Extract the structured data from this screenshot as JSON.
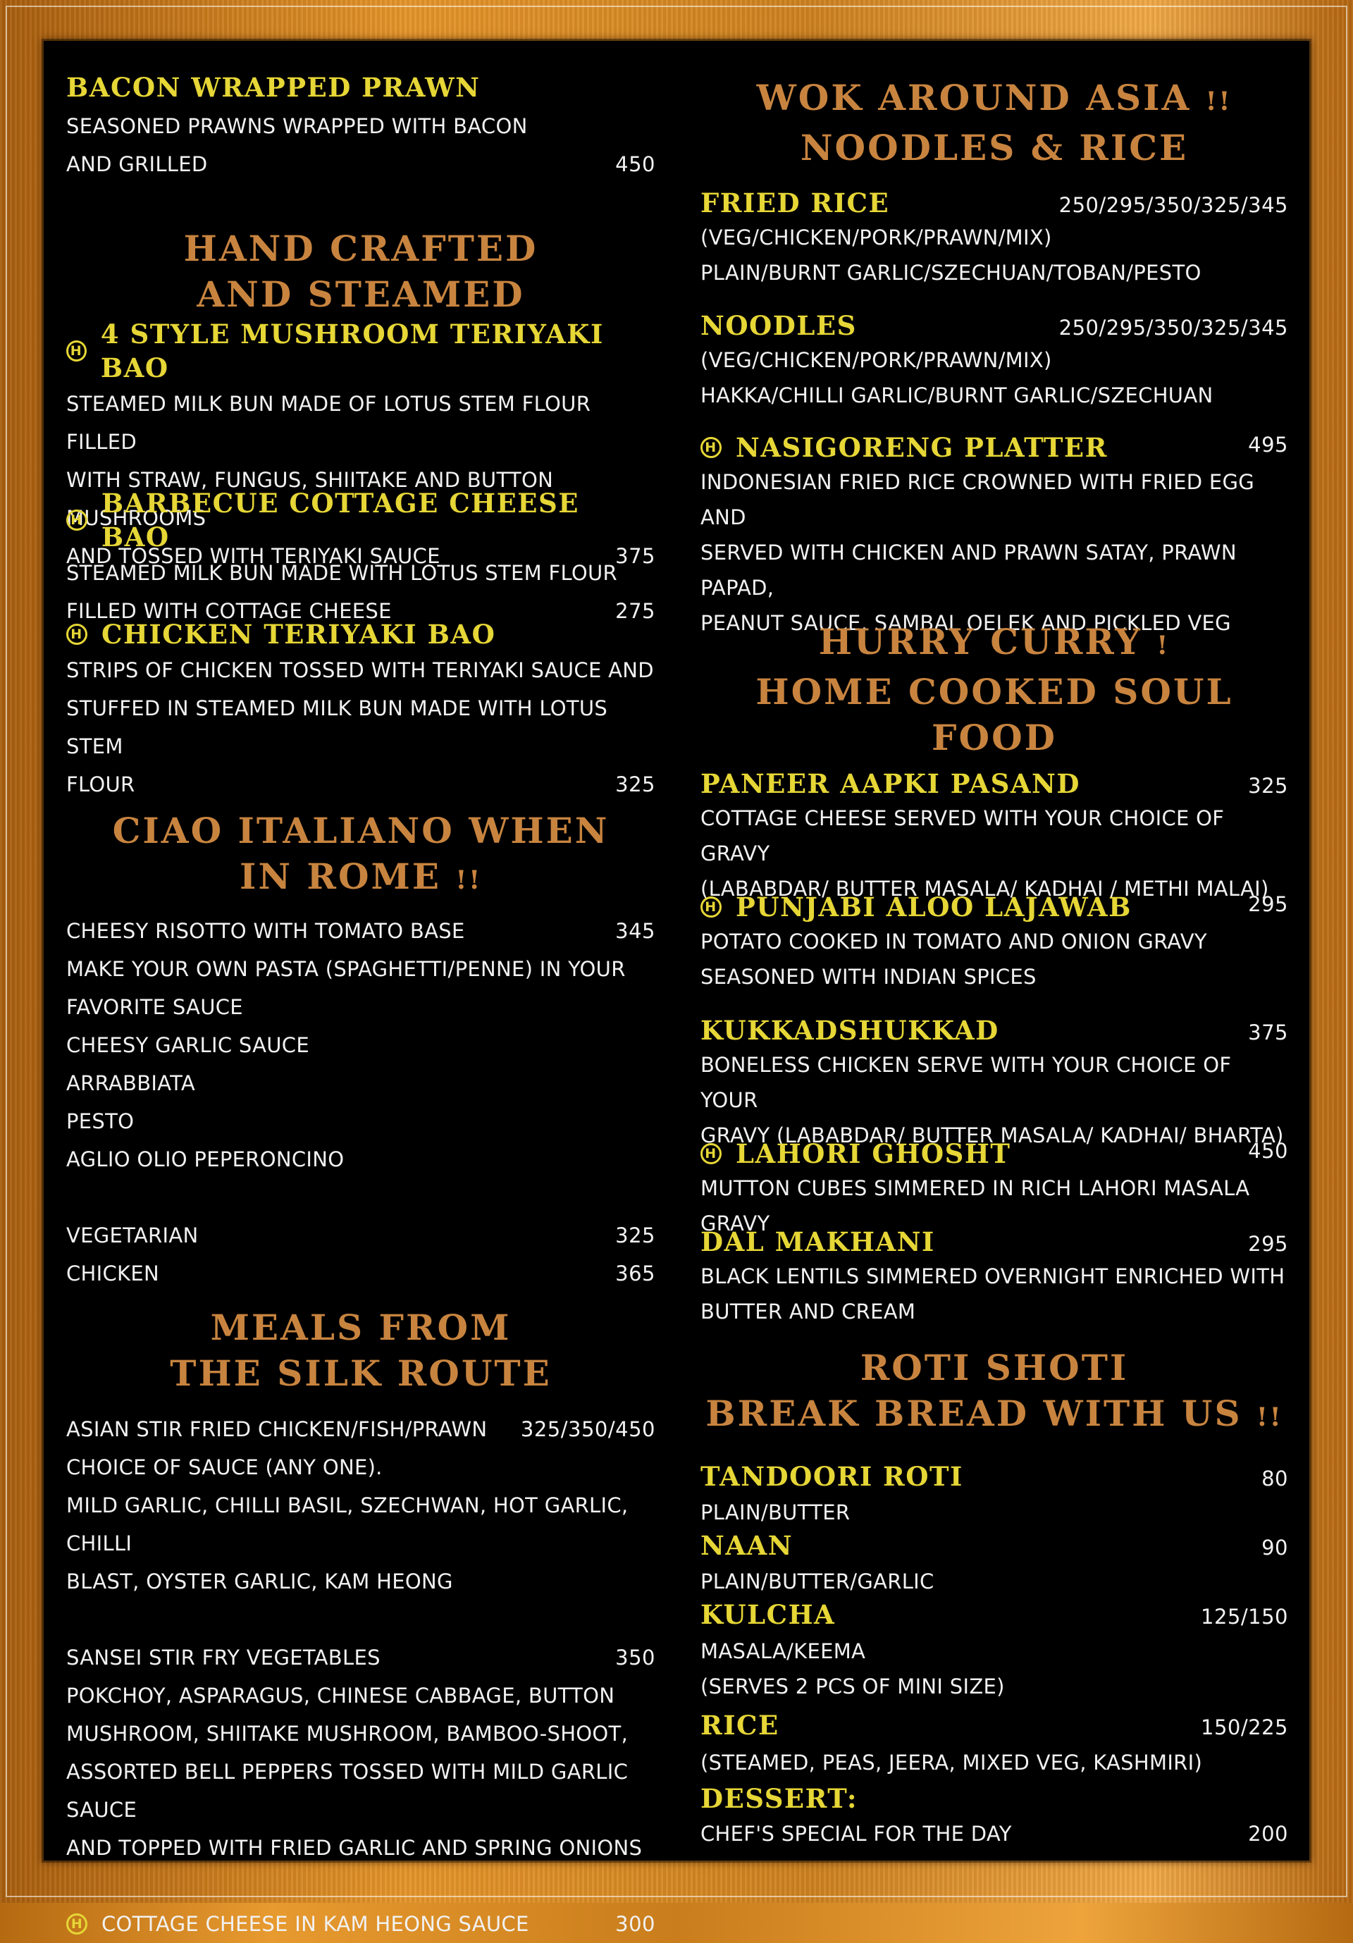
{
  "left": {
    "bacon": {
      "name": "BACON WRAPPED PRAWN",
      "desc1": "SEASONED PRAWNS WRAPPED WITH BACON",
      "desc2": "AND GRILLED",
      "price": "450"
    },
    "h1": {
      "line1": "HAND CRAFTED",
      "line2": "AND STEAMED"
    },
    "mushroom_bao": {
      "name": "4 STYLE MUSHROOM TERIYAKI BAO",
      "desc1": "STEAMED MILK BUN MADE OF LOTUS STEM FLOUR FILLED",
      "desc2": "WITH STRAW, FUNGUS, SHIITAKE AND BUTTON MUSHROOMS",
      "desc3": "AND TOSSED WITH TERIYAKI SAUCE",
      "price": "375"
    },
    "cheese_bao": {
      "name": "BARBECUE COTTAGE CHEESE BAO",
      "desc1": "STEAMED MILK BUN MADE WITH LOTUS STEM FLOUR",
      "desc2": "FILLED WITH COTTAGE CHEESE",
      "price": "275"
    },
    "chicken_bao": {
      "name": "CHICKEN TERIYAKI BAO",
      "desc1": "STRIPS OF CHICKEN TOSSED WITH TERIYAKI SAUCE AND",
      "desc2": "STUFFED IN STEAMED MILK BUN MADE WITH LOTUS STEM",
      "desc3": "FLOUR",
      "price": "325"
    },
    "h2": {
      "line1": "CIAO ITALIANO WHEN",
      "line2": "IN ROME",
      "bang": "!!"
    },
    "italian": {
      "risotto": "CHEESY RISOTTO WITH TOMATO BASE",
      "risotto_price": "345",
      "pasta1": "MAKE YOUR OWN PASTA (SPAGHETTI/PENNE) IN YOUR",
      "pasta2": "FAVORITE SAUCE",
      "sauce1": "CHEESY GARLIC SAUCE",
      "sauce2": "ARRABBIATA",
      "sauce3": "PESTO",
      "sauce4": "AGLIO OLIO PEPERONCINO",
      "veg": "VEGETARIAN",
      "veg_price": "325",
      "chicken": "CHICKEN",
      "chicken_price": "365"
    },
    "h3": {
      "line1": "MEALS FROM",
      "line2": "THE SILK ROUTE"
    },
    "silk": {
      "stirfry": "ASIAN STIR FRIED CHICKEN/FISH/PRAWN",
      "stirfry_price": "325/350/450",
      "choice": "CHOICE OF SAUCE (ANY ONE).",
      "sauces1": "MILD GARLIC, CHILLI BASIL, SZECHWAN, HOT GARLIC, CHILLI",
      "sauces2": "BLAST, OYSTER GARLIC, KAM HEONG",
      "sansei": "SANSEI STIR FRY VEGETABLES",
      "sansei_price": "350",
      "sansei1": "POKCHOY, ASPARAGUS, CHINESE CABBAGE, BUTTON",
      "sansei2": "MUSHROOM, SHIITAKE MUSHROOM, BAMBOO-SHOOT,",
      "sansei3": "ASSORTED BELL PEPPERS TOSSED WITH MILD GARLIC SAUCE",
      "sansei4": "AND TOPPED WITH FRIED GARLIC AND SPRING ONIONS",
      "kam": "COTTAGE CHEESE IN KAM HEONG SAUCE",
      "kam_price": "300"
    }
  },
  "right": {
    "h1": {
      "line1": "WOK AROUND ASIA",
      "bang": "!!",
      "line2": "NOODLES & RICE"
    },
    "fried_rice": {
      "name": "FRIED RICE",
      "price": "250/295/350/325/345",
      "desc1": "(VEG/CHICKEN/PORK/PRAWN/MIX)",
      "desc2": "PLAIN/BURNT GARLIC/SZECHUAN/TOBAN/PESTO"
    },
    "noodles": {
      "name": "NOODLES",
      "price": "250/295/350/325/345",
      "desc1": "(VEG/CHICKEN/PORK/PRAWN/MIX)",
      "desc2": "HAKKA/CHILLI GARLIC/BURNT GARLIC/SZECHUAN"
    },
    "nasi": {
      "name": "NASIGORENG PLATTER",
      "price": "495",
      "desc1": "INDONESIAN FRIED RICE CROWNED WITH FRIED EGG AND",
      "desc2": "SERVED WITH CHICKEN AND PRAWN SATAY, PRAWN PAPAD,",
      "desc3": "PEANUT SAUCE, SAMBAL OELEK AND PICKLED VEG"
    },
    "h2": {
      "line1": "HURRY CURRY",
      "bang": "!",
      "line2": "HOME COOKED SOUL",
      "line3": "FOOD"
    },
    "paneer": {
      "name": "PANEER AAPKI PASAND",
      "price": "325",
      "desc1": "COTTAGE CHEESE SERVED WITH YOUR CHOICE OF GRAVY",
      "desc2": "(LABABDAR/ BUTTER MASALA/ KADHAI / METHI MALAI)"
    },
    "aloo": {
      "name": "PUNJABI ALOO LAJAWAB",
      "price": "295",
      "desc1": "POTATO COOKED IN TOMATO AND ONION GRAVY",
      "desc2": "SEASONED WITH INDIAN SPICES"
    },
    "kukkad": {
      "name": "KUKKADSHUKKAD",
      "price": "375",
      "desc1": "BONELESS CHICKEN SERVE WITH YOUR CHOICE OF YOUR",
      "desc2": "GRAVY (LABABDAR/ BUTTER MASALA/ KADHAI/ BHARTA)"
    },
    "lahori": {
      "name": "LAHORI GHOSHT",
      "price": "450",
      "desc1": "MUTTON CUBES SIMMERED IN RICH LAHORI MASALA GRAVY"
    },
    "dal": {
      "name": "DAL MAKHANI",
      "price": "295",
      "desc1": "BLACK LENTILS SIMMERED OVERNIGHT ENRICHED WITH",
      "desc2": "BUTTER AND CREAM"
    },
    "h3": {
      "line1": "ROTI SHOTI",
      "line2": "BREAK BREAD WITH US",
      "bang": "!!"
    },
    "roti": {
      "name": "TANDOORI ROTI",
      "price": "80",
      "desc1": "PLAIN/BUTTER"
    },
    "naan": {
      "name": "NAAN",
      "price": "90",
      "desc1": "PLAIN/BUTTER/GARLIC"
    },
    "kulcha": {
      "name": "KULCHA",
      "price": "125/150",
      "desc1": "MASALA/KEEMA",
      "desc2": "(SERVES 2 PCS OF MINI SIZE)"
    },
    "rice": {
      "name": "RICE",
      "price": "150/225",
      "desc1": "(STEAMED, PEAS, JEERA, MIXED VEG, KASHMIRI)"
    },
    "dessert": {
      "name": "DESSERT:",
      "desc1": "CHEF'S SPECIAL FOR THE DAY",
      "price": "200"
    }
  },
  "icons": {
    "halal_mark": "H"
  },
  "colors": {
    "heading": "#c8843f",
    "item_name": "#e6d636",
    "text": "#f1f1f1",
    "board": "#000000",
    "frame": "#d98a24"
  }
}
